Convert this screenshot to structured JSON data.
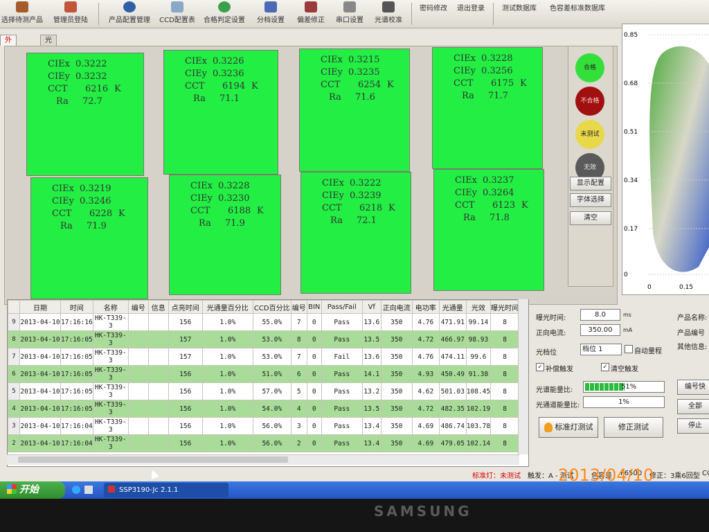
{
  "toolbar": {
    "items": [
      "选择待测产品",
      "管理员登陆",
      "产品配置管理",
      "CCD配置表",
      "合格判定设置",
      "分档设置",
      "偏差修正",
      "串口设置",
      "光谱校准",
      "密码修改",
      "退出登录",
      "测试数据库",
      "色容差标准数据库"
    ]
  },
  "tabs": [
    "外观显示",
    "光谱曲线"
  ],
  "tiles": [
    {
      "x_label": "CIEx",
      "x": "0.3222",
      "y_label": "CIEy",
      "y": "0.3232",
      "cct_label": "CCT",
      "cct": "6216",
      "k": "K",
      "ra_label": "Ra",
      "ra": "72.7"
    },
    {
      "x_label": "CIEx",
      "x": "0.3226",
      "y_label": "CIEy",
      "y": "0.3236",
      "cct_label": "CCT",
      "cct": "6194",
      "k": "K",
      "ra_label": "Ra",
      "ra": "71.1"
    },
    {
      "x_label": "CIEx",
      "x": "0.3215",
      "y_label": "CIEy",
      "y": "0.3235",
      "cct_label": "CCT",
      "cct": "6254",
      "k": "K",
      "ra_label": "Ra",
      "ra": "71.6"
    },
    {
      "x_label": "CIEx",
      "x": "0.3228",
      "y_label": "CIEy",
      "y": "0.3256",
      "cct_label": "CCT",
      "cct": "6175",
      "k": "K",
      "ra_label": "Ra",
      "ra": "71.7"
    },
    {
      "x_label": "CIEx",
      "x": "0.3219",
      "y_label": "CIEy",
      "y": "0.3246",
      "cct_label": "CCT",
      "cct": "6228",
      "k": "K",
      "ra_label": "Ra",
      "ra": "71.9"
    },
    {
      "x_label": "CIEx",
      "x": "0.3228",
      "y_label": "CIEy",
      "y": "0.3230",
      "cct_label": "CCT",
      "cct": "6188",
      "k": "K",
      "ra_label": "Ra",
      "ra": "71.9"
    },
    {
      "x_label": "CIEx",
      "x": "0.3222",
      "y_label": "CIEy",
      "y": "0.3239",
      "cct_label": "CCT",
      "cct": "6218",
      "k": "K",
      "ra_label": "Ra",
      "ra": "72.1"
    },
    {
      "x_label": "CIEx",
      "x": "0.3237",
      "y_label": "CIEy",
      "y": "0.3264",
      "cct_label": "CCT",
      "cct": "6123",
      "k": "K",
      "ra_label": "Ra",
      "ra": "71.8"
    }
  ],
  "status_lamps": {
    "pass": {
      "label": "合格",
      "color": "#33e03a"
    },
    "fail": {
      "label": "不合格",
      "color": "#a01010"
    },
    "untested": {
      "label": "未测试",
      "color": "#e8d84a"
    },
    "none": {
      "label": "无效",
      "color": "#5a5a5a"
    }
  },
  "side_buttons": [
    "显示配置",
    "字体选择",
    "清空"
  ],
  "cie_chart": {
    "y_ticks": [
      "0.85",
      "0.68",
      "0.51",
      "0.34",
      "0.17",
      "0"
    ],
    "x_ticks": [
      "0",
      "0.15"
    ]
  },
  "grid": {
    "headers": [
      "日期",
      "时间",
      "名称",
      "编号",
      "信息",
      "点亮时间",
      "光通量百分比",
      "CCD百分比",
      "编号",
      "BIN",
      "Pass/Fail",
      "Vf",
      "正向电流",
      "电功率",
      "光通量",
      "光效",
      "曝光时间"
    ],
    "rows": [
      {
        "n": "9",
        "cells": [
          "2013-04-10",
          "17:16:16",
          "HK-T339-3",
          "",
          "",
          "156",
          "1.0%",
          "55.0%",
          "7",
          "0",
          "Pass",
          "13.6",
          "350",
          "4.76",
          "471.91",
          "99.14",
          "8"
        ]
      },
      {
        "n": "8",
        "cells": [
          "2013-04-10",
          "17:16:05",
          "HK-T339-3",
          "",
          "",
          "157",
          "1.0%",
          "53.0%",
          "8",
          "0",
          "Pass",
          "13.5",
          "350",
          "4.72",
          "466.97",
          "98.93",
          "8"
        ]
      },
      {
        "n": "7",
        "cells": [
          "2013-04-10",
          "17:16:05",
          "HK-T339-3",
          "",
          "",
          "157",
          "1.0%",
          "53.0%",
          "7",
          "0",
          "Fail",
          "13.6",
          "350",
          "4.76",
          "474.11",
          "99.6",
          "8"
        ]
      },
      {
        "n": "6",
        "cells": [
          "2013-04-10",
          "17:16:05",
          "HK-T339-3",
          "",
          "",
          "156",
          "1.0%",
          "51.0%",
          "6",
          "0",
          "Pass",
          "14.1",
          "350",
          "4.93",
          "450.49",
          "91.38",
          "8"
        ]
      },
      {
        "n": "5",
        "cells": [
          "2013-04-10",
          "17:16:05",
          "HK-T339-3",
          "",
          "",
          "156",
          "1.0%",
          "57.0%",
          "5",
          "0",
          "Pass",
          "13.2",
          "350",
          "4.62",
          "501.03",
          "108.45",
          "8"
        ]
      },
      {
        "n": "4",
        "cells": [
          "2013-04-10",
          "17:16:05",
          "HK-T339-3",
          "",
          "",
          "156",
          "1.0%",
          "54.0%",
          "4",
          "0",
          "Pass",
          "13.5",
          "350",
          "4.72",
          "482.35",
          "102.19",
          "8"
        ]
      },
      {
        "n": "3",
        "cells": [
          "2013-04-10",
          "17:16:04",
          "HK-T339-3",
          "",
          "",
          "156",
          "1.0%",
          "56.0%",
          "3",
          "0",
          "Pass",
          "13.4",
          "350",
          "4.69",
          "486.74",
          "103.78",
          "8"
        ]
      },
      {
        "n": "2",
        "cells": [
          "2013-04-10",
          "17:16:04",
          "HK-T339-3",
          "",
          "",
          "156",
          "1.0%",
          "56.0%",
          "2",
          "0",
          "Pass",
          "13.4",
          "350",
          "4.69",
          "479.05",
          "102.14",
          "8"
        ]
      }
    ]
  },
  "controls": {
    "exposure_label": "曝光时间:",
    "exposure_value": "8.0",
    "exposure_unit": "ms",
    "current_label": "正向电流:",
    "current_value": "350.00",
    "current_unit": "mA",
    "gear_label": "光档位",
    "gear_value": "档位 1",
    "auto_gear": "自动量程",
    "comp_trigger": "补偿触发",
    "clear_trigger": "清空触发",
    "energy_label": "光谱能量比:",
    "energy_value": "51%",
    "channel_label": "光通道能量比:",
    "channel_value": "1%",
    "std_btn": "标准灯测试",
    "fix_btn": "修正测试",
    "product_name": "产品名称:",
    "product_no": "产品编号",
    "other_info": "其他信息:",
    "right_btns": [
      "编号快",
      "全部",
      "停止"
    ]
  },
  "statusbar": {
    "std_lamp": "标准灯：未测试",
    "trigger": "触发：A - 测试",
    "tolerance": "色容差",
    "tolerance_val": "F6500",
    "fix": "修正：3乘6回型",
    "tail": "CO"
  },
  "taskbar": {
    "start": "开始",
    "task": "SSP3190-Jc 2.1.1"
  },
  "bezel_brand": "SAMSUNG",
  "photo_date": "2013/04/10"
}
